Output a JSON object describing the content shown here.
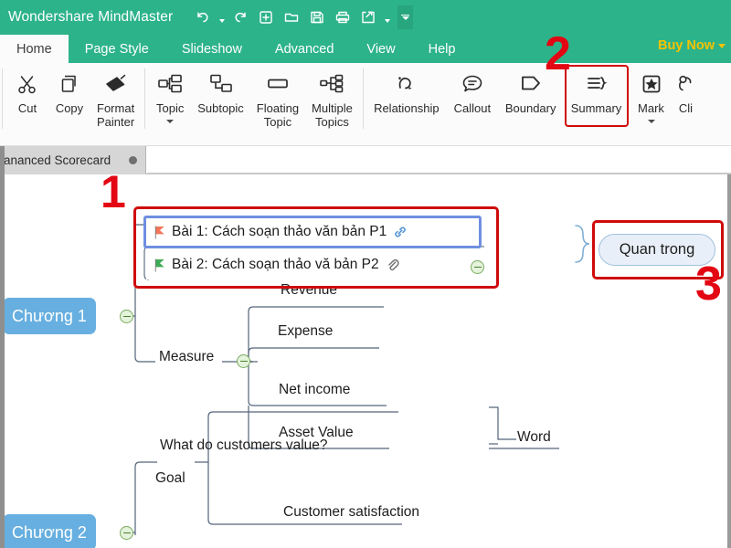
{
  "window": {
    "app_title": "Wondershare MindMaster",
    "brand_green": "#2db389",
    "quick_access": [
      {
        "name": "undo-icon",
        "label": "Undo",
        "has_dropdown": true
      },
      {
        "name": "redo-icon",
        "label": "Redo",
        "has_dropdown": false
      },
      {
        "name": "new-icon",
        "label": "New",
        "has_dropdown": false
      },
      {
        "name": "open-folder-icon",
        "label": "Open",
        "has_dropdown": false
      },
      {
        "name": "save-icon",
        "label": "Save",
        "has_dropdown": false
      },
      {
        "name": "print-icon",
        "label": "Print",
        "has_dropdown": false
      },
      {
        "name": "export-share-icon",
        "label": "Export",
        "has_dropdown": true
      }
    ]
  },
  "ribbon_tabs": {
    "items": [
      {
        "label": "Home",
        "active": true
      },
      {
        "label": "Page Style",
        "active": false
      },
      {
        "label": "Slideshow",
        "active": false
      },
      {
        "label": "Advanced",
        "active": false
      },
      {
        "label": "View",
        "active": false
      },
      {
        "label": "Help",
        "active": false
      }
    ],
    "buy_now": "Buy Now"
  },
  "ribbon": {
    "groups": [
      {
        "buttons": [
          {
            "label": "Cut",
            "icon": "scissors-icon",
            "dropdown": false,
            "highlighted": false
          },
          {
            "label": "Copy",
            "icon": "copy-icon",
            "dropdown": false,
            "highlighted": false
          },
          {
            "label": "Format\nPainter",
            "icon": "format-painter-icon",
            "dropdown": false,
            "highlighted": false
          }
        ]
      },
      {
        "buttons": [
          {
            "label": "Topic",
            "icon": "topic-icon",
            "dropdown": true,
            "highlighted": false
          },
          {
            "label": "Subtopic",
            "icon": "subtopic-icon",
            "dropdown": false,
            "highlighted": false
          },
          {
            "label": "Floating\nTopic",
            "icon": "floating-topic-icon",
            "dropdown": false,
            "highlighted": false
          },
          {
            "label": "Multiple\nTopics",
            "icon": "multiple-topics-icon",
            "dropdown": false,
            "highlighted": false
          }
        ]
      },
      {
        "buttons": [
          {
            "label": "Relationship",
            "icon": "relationship-icon",
            "dropdown": false,
            "highlighted": false
          },
          {
            "label": "Callout",
            "icon": "callout-icon",
            "dropdown": false,
            "highlighted": false
          },
          {
            "label": "Boundary",
            "icon": "boundary-icon",
            "dropdown": false,
            "highlighted": false
          },
          {
            "label": "Summary",
            "icon": "summary-icon",
            "dropdown": false,
            "highlighted": true
          },
          {
            "label": "Mark",
            "icon": "mark-star-icon",
            "dropdown": true,
            "highlighted": false
          },
          {
            "label": "Cli",
            "icon": "clipart-icon",
            "dropdown": false,
            "highlighted": false
          }
        ]
      }
    ],
    "highlight_color": "#cf0a0a"
  },
  "document_tabs": {
    "active_tab_label": "ananced Scorecard",
    "modified_dot": true
  },
  "mindmap": {
    "selected_topic": {
      "text": "Bài 1: Cách soạn thảo văn bản P1",
      "flag_color": "#f4765a",
      "attachment_icon": "hyperlink-icon",
      "selection_color": "#6f8fe0"
    },
    "sibling_topic": {
      "text": "Bài 2: Cách soạn thảo vă bản P2",
      "flag_color": "#3eac54",
      "attachment_icon": "paperclip-icon"
    },
    "parent_topic": {
      "text": "Word"
    },
    "summary_topic": {
      "text": "Quan trong",
      "fill": "#e9eff8",
      "border": "#9fc2de"
    },
    "chapter_1": {
      "text": "Chương 1",
      "fill": "#67afe0"
    },
    "chapter_2": {
      "text": "Chương 2",
      "fill": "#67afe0"
    },
    "measure_branch": {
      "label": "Measure",
      "children": [
        "Revenue",
        "Expense",
        "Net income",
        "Asset Value"
      ]
    },
    "goal_branch": {
      "question": "What do customers value?",
      "label": "Goal",
      "children": [
        "Customer satisfaction"
      ]
    }
  },
  "annotations": [
    {
      "number": "1",
      "target": "document-tab-and-topics"
    },
    {
      "number": "2",
      "target": "ribbon-summary-button"
    },
    {
      "number": "3",
      "target": "summary-topic"
    }
  ]
}
